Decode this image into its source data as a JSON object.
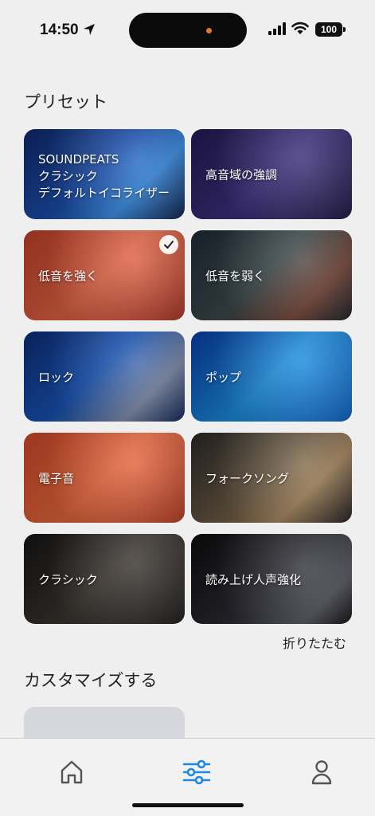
{
  "status": {
    "time": "14:50",
    "battery": "100"
  },
  "presets_title": "プリセット",
  "presets": [
    {
      "lines": [
        "SOUNDPEATS",
        "クラシック",
        "デフォルトイコライザー"
      ],
      "selected": false,
      "bg": "linear-gradient(135deg,#0f2a6e 0%,#1c4fb0 45%,#2a7fd6 70%,#0b1d4a 100%)"
    },
    {
      "lines": [
        "高音域の強調"
      ],
      "selected": false,
      "bg": "linear-gradient(135deg,#241a55 0%,#3c2f7e 50%,#1a1440 100%)"
    },
    {
      "lines": [
        "低音を強く"
      ],
      "selected": true,
      "bg": "linear-gradient(135deg,#c6402a 0%,#e26445 50%,#a73222 100%)"
    },
    {
      "lines": [
        "低音を弱く"
      ],
      "selected": false,
      "bg": "linear-gradient(135deg,#1e2a35 0%,#3c4a4e 45%,#6b3b2c 75%,#1b1f26 100%)"
    },
    {
      "lines": [
        "ロック"
      ],
      "selected": false,
      "bg": "linear-gradient(135deg,#0b2d7a 0%,#1955b8 45%,#6f7c9a 75%,#0d2257 100%)"
    },
    {
      "lines": [
        "ポップ"
      ],
      "selected": false,
      "bg": "linear-gradient(135deg,#0a3fae 0%,#1b8fe0 50%,#0b5fc4 100%)"
    },
    {
      "lines": [
        "電子音"
      ],
      "selected": false,
      "bg": "linear-gradient(135deg,#d24a2a 0%,#e9683d 50%,#b33a22 100%)"
    },
    {
      "lines": [
        "フォークソング"
      ],
      "selected": false,
      "bg": "linear-gradient(135deg,#2a2a2a 0%,#6b5a43 45%,#9a7a52 70%,#1e1e1e 100%)"
    },
    {
      "lines": [
        "クラシック"
      ],
      "selected": false,
      "bg": "linear-gradient(135deg,#151515 0%,#3b3530 50%,#1c1a18 100%)"
    },
    {
      "lines": [
        "読み上げ人声強化"
      ],
      "selected": false,
      "bg": "linear-gradient(135deg,#0d0d0d 0%,#2b2b33 50%,#4a4a55 80%,#111 100%)"
    }
  ],
  "collapse_label": "折りたたむ",
  "custom_title": "カスタマイズする",
  "tabs": [
    {
      "icon": "home-icon",
      "active": false
    },
    {
      "icon": "equalizer-icon",
      "active": true
    },
    {
      "icon": "profile-icon",
      "active": false
    }
  ],
  "colors": {
    "accent": "#1e88e5",
    "inactive_icon": "#555555"
  }
}
